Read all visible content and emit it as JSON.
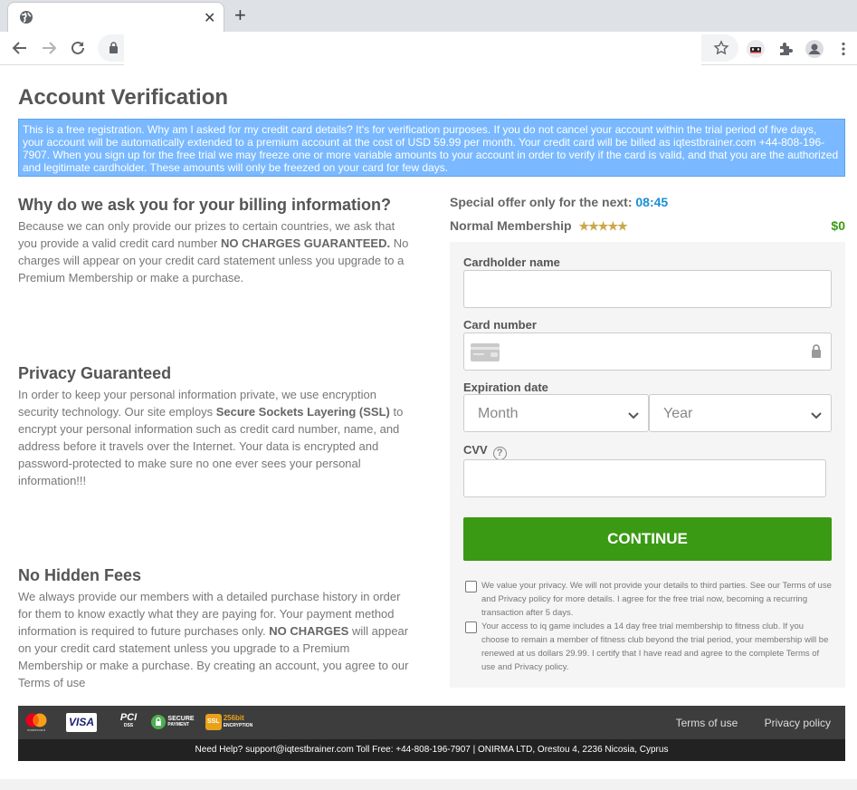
{
  "browser": {
    "tab_title": "",
    "url": "",
    "icons": [
      "globe-icon",
      "close-icon",
      "plus-icon",
      "back-icon",
      "forward-icon",
      "reload-icon",
      "lock-icon",
      "star-icon",
      "incognito-extension-icon",
      "puzzle-extensions-icon",
      "profile-icon",
      "more-vert-icon"
    ]
  },
  "page": {
    "title": "Account Verification",
    "notice": "This is a free registration. Why am I asked for my credit card details? It's for verification purposes. If you do not cancel your account within the trial period of five days, your account will be automatically extended to a premium account at the cost of USD 59.99 per month. Your credit card will be billed as iqtestbrainer.com +44-808-196-7907. When you sign up for the free trial we may freeze one or more variable amounts to your account in order to verify if the card is valid, and that you are the authorized and legitimate cardholder. These amounts will only be freezed on your card for few days."
  },
  "sections": [
    {
      "heading": "Why do we ask you for your billing information?",
      "text_before": "Because we can only provide our prizes to certain countries, we ask that you provide a valid credit card number ",
      "bold": "NO CHARGES GUARANTEED.",
      "text_after": " No charges will appear on your credit card statement unless you upgrade to a Premium Membership or make a purchase."
    },
    {
      "heading": "Privacy Guaranteed",
      "text_before": "In order to keep your personal information private, we use encryption security technology. Our site employs ",
      "bold": "Secure Sockets Layering (SSL)",
      "text_after": " to encrypt your personal information such as credit card number, name, and address before it travels over the Internet. Your data is encrypted and password-protected to make sure no one ever sees your personal information!!!"
    },
    {
      "heading": "No Hidden Fees",
      "text_before": "We always provide our members with a detailed purchase history in order for them to know exactly what they are paying for. Your payment method information is required to future purchases only. ",
      "bold": "NO CHARGES",
      "text_after": " will appear on your credit card statement unless you upgrade to a Premium Membership or make a purchase. By creating an account, you agree to our Terms of use"
    }
  ],
  "offer": {
    "label": "Special offer only for the next:",
    "timer": "08:45",
    "membership_label": "Normal Membership",
    "stars": "★★★★★",
    "rating": 5,
    "price": "$0"
  },
  "form": {
    "cardholder_label": "Cardholder name",
    "cardholder_value": "",
    "card_number_label": "Card number",
    "card_number_value": "",
    "expiration_label": "Expiration date",
    "month_value": "Month",
    "year_value": "Year",
    "cvv_label": "CVV",
    "cvv_help": "?",
    "cvv_value": "",
    "continue_label": "CONTINUE",
    "consent_1": "We value your privacy. We will not provide your details to third parties. See our Terms of use and Privacy policy for more details. I agree for the free trial now, becoming a recurring transaction after 5 days.",
    "consent_2": "Your access to iq game includes a 14 day free trial membership to fitness club. If you choose to remain a member of fitness club beyond the trial period, your membership will be renewed at us dollars 29.99. I certify that I have read and agree to the complete Terms of use and Privacy policy."
  },
  "footer": {
    "logos": {
      "mastercard": "mastercard",
      "visa": "VISA",
      "pci": "PCI",
      "pci_sub": "DSS",
      "secure_top": "SECURE",
      "secure_bottom": "PAYMENT",
      "ssl": "SSL",
      "ssl_bits": "256bit",
      "ssl_sub": "ENCRYPTION"
    },
    "terms_link": "Terms of use",
    "privacy_link": "Privacy policy",
    "help_text": "Need Help? support@iqtestbrainer.com Toll Free: +44-808-196-7907 | ONIRMA LTD, Orestou 4, 2236 Nicosia, Cyprus"
  },
  "colors": {
    "accent_green": "#3a9a14",
    "notice_blue": "#7ab9ff",
    "timer_blue": "#1a8fd6",
    "star_gold": "#c9a94d"
  }
}
